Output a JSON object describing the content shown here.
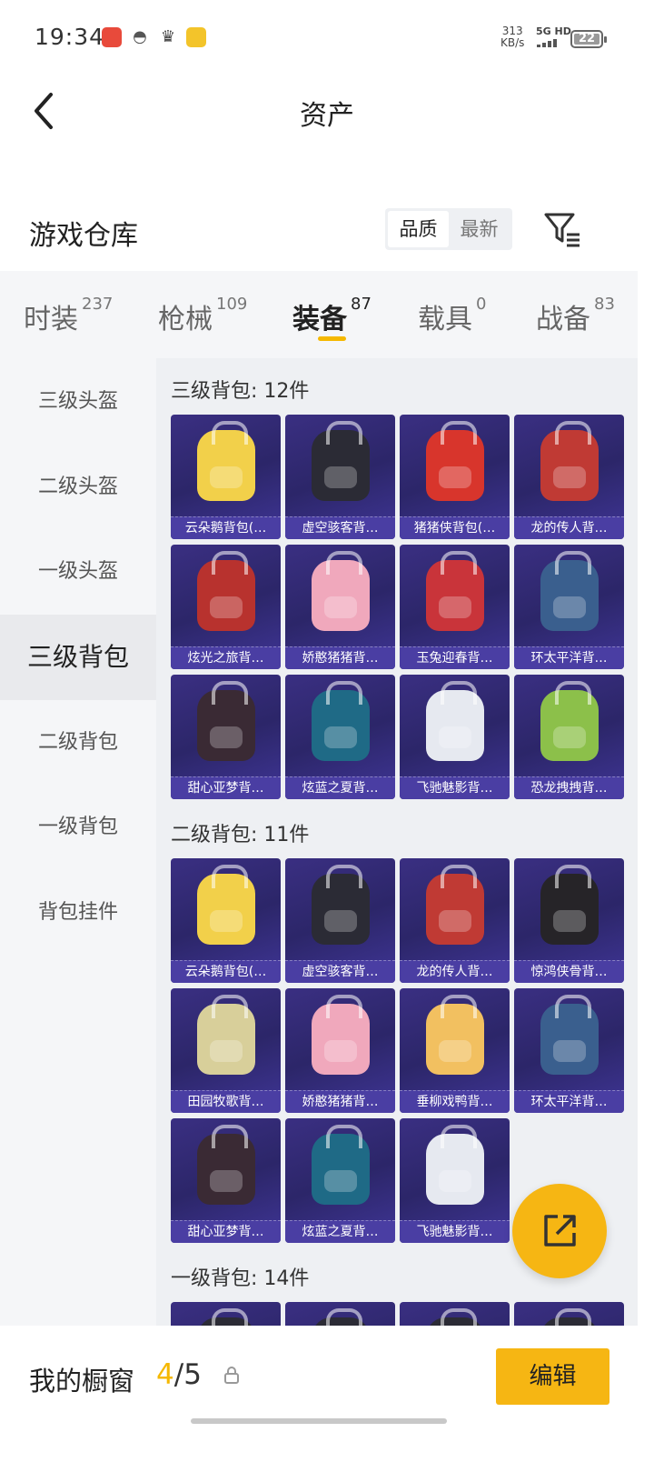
{
  "status_bar": {
    "time": "19:34",
    "net_speed_value": "313",
    "net_speed_unit": "KB/s",
    "network": "5G HD",
    "battery": "22",
    "icons": [
      "app-red-icon",
      "wechat-icon",
      "crown-icon",
      "app-yellow-icon"
    ]
  },
  "header": {
    "title": "资产",
    "back_icon": "chevron-left-icon"
  },
  "section": {
    "title": "游戏仓库",
    "sort_options": [
      "品质",
      "最新"
    ],
    "sort_selected": "品质",
    "filter_icon": "filter-icon"
  },
  "tabs": [
    {
      "label": "时装",
      "count": "237"
    },
    {
      "label": "枪械",
      "count": "109"
    },
    {
      "label": "装备",
      "count": "87",
      "active": true
    },
    {
      "label": "载具",
      "count": "0"
    },
    {
      "label": "战备",
      "count": "83"
    }
  ],
  "sidebar": [
    {
      "label": "三级头盔"
    },
    {
      "label": "二级头盔"
    },
    {
      "label": "一级头盔"
    },
    {
      "label": "三级背包",
      "active": true
    },
    {
      "label": "二级背包"
    },
    {
      "label": "一级背包"
    },
    {
      "label": "背包挂件"
    }
  ],
  "groups": [
    {
      "title": "三级背包: 12件",
      "items": [
        {
          "name": "云朵鹅背包(…",
          "color": "#f2d04a"
        },
        {
          "name": "虚空骇客背…",
          "color": "#2b2b35"
        },
        {
          "name": "猪猪侠背包(…",
          "color": "#d8352c"
        },
        {
          "name": "龙的传人背…",
          "color": "#c03a34"
        },
        {
          "name": "炫光之旅背…",
          "color": "#b8322e"
        },
        {
          "name": "娇憨猪猪背…",
          "color": "#f0a8bc"
        },
        {
          "name": "玉兔迎春背…",
          "color": "#c9343a"
        },
        {
          "name": "环太平洋背…",
          "color": "#3a5f8e"
        },
        {
          "name": "甜心亚梦背…",
          "color": "#3a2a34"
        },
        {
          "name": "炫蓝之夏背…",
          "color": "#1f6a86"
        },
        {
          "name": "飞驰魅影背…",
          "color": "#e6e9f0"
        },
        {
          "name": "恐龙拽拽背…",
          "color": "#8cc04a"
        }
      ]
    },
    {
      "title": "二级背包: 11件",
      "items": [
        {
          "name": "云朵鹅背包(…",
          "color": "#f2d04a"
        },
        {
          "name": "虚空骇客背…",
          "color": "#2b2b35"
        },
        {
          "name": "龙的传人背…",
          "color": "#c03a34"
        },
        {
          "name": "惊鸿侠骨背…",
          "color": "#262428"
        },
        {
          "name": "田园牧歌背…",
          "color": "#d8cf9a"
        },
        {
          "name": "娇憨猪猪背…",
          "color": "#f0a8bc"
        },
        {
          "name": "垂柳戏鸭背…",
          "color": "#f2c060"
        },
        {
          "name": "环太平洋背…",
          "color": "#3a5f8e"
        },
        {
          "name": "甜心亚梦背…",
          "color": "#3a2a34"
        },
        {
          "name": "炫蓝之夏背…",
          "color": "#1f6a86"
        },
        {
          "name": "飞驰魅影背…",
          "color": "#e6e9f0"
        }
      ]
    },
    {
      "title": "一级背包: 14件",
      "items": [
        {
          "name": "",
          "color": "#2b2b35"
        },
        {
          "name": "",
          "color": "#2b2b35"
        },
        {
          "name": "",
          "color": "#2b2b35"
        },
        {
          "name": "",
          "color": "#2b2b35"
        }
      ]
    }
  ],
  "fab": {
    "icon": "share-external-icon"
  },
  "bottom": {
    "showcase_label": "我的橱窗",
    "showcase_current": "4",
    "showcase_sep": "/",
    "showcase_total": "5",
    "lock_icon": "lock-icon",
    "edit_label": "编辑"
  },
  "theme": {
    "accent": "#f6b613",
    "card_bg": "#2c2669",
    "card_label_bg": "#4a3ea3"
  }
}
